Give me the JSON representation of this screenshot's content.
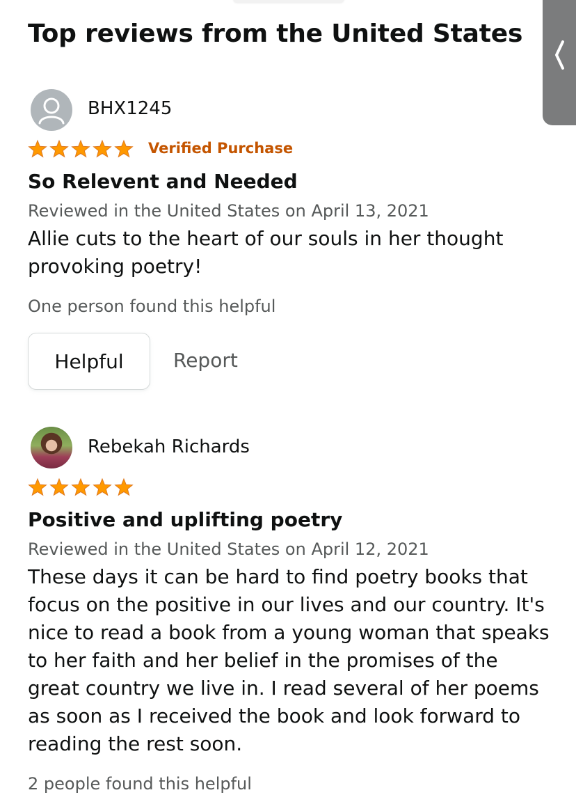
{
  "section": {
    "title": "Top reviews from the United States"
  },
  "side_tab": {
    "icon": "chevron-left-icon"
  },
  "star_color": "#ff9900",
  "reviews": [
    {
      "reviewer": "BHX1245",
      "rating": 5,
      "rating_max": 5,
      "verified": "Verified Purchase",
      "title": "So Relevent and Needed",
      "date": "Reviewed in the United States on April 13, 2021",
      "body": "Allie cuts to the heart of our souls in her thought provoking poetry!",
      "helpful_count": "One person found this helpful",
      "helpful_label": "Helpful",
      "report_label": "Report",
      "avatar": "default-profile-icon"
    },
    {
      "reviewer": "Rebekah Richards",
      "rating": 5,
      "rating_max": 5,
      "title": "Positive and uplifting poetry",
      "date": "Reviewed in the United States on April 12, 2021",
      "body": "These days it can be hard to find poetry books that focus on the positive in our lives and our country. It's nice to read a book from a young woman that speaks to her faith and her belief in the promises of the great country we live in. I read several of her poems as soon as I received the book and look forward to reading the rest soon.",
      "helpful_count": "2 people found this helpful",
      "avatar": "reviewer-photo"
    }
  ]
}
